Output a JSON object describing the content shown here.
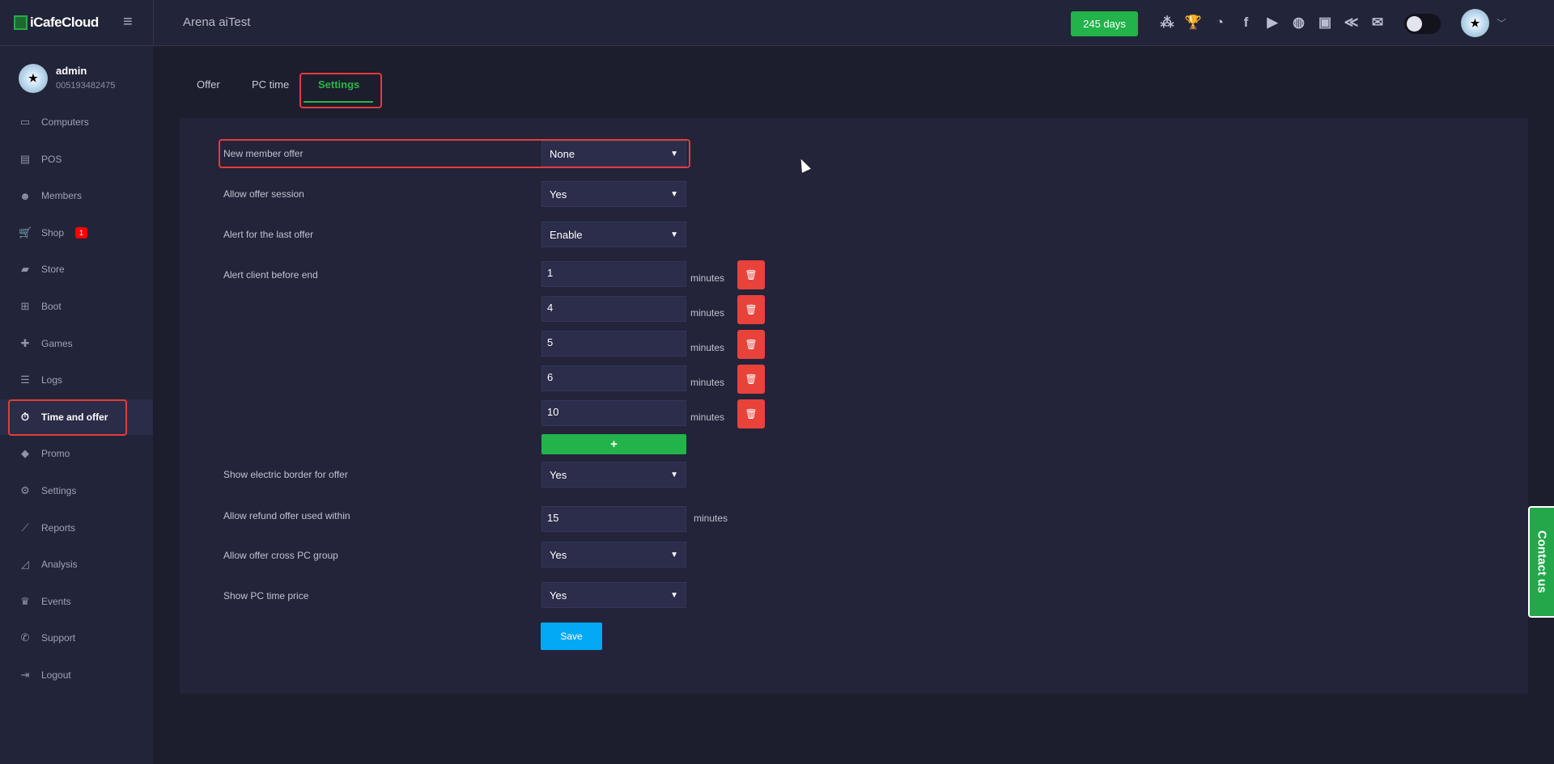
{
  "header": {
    "brand": "iCafeCloud",
    "title": "Arena aiTest",
    "days_badge": "245 days",
    "icons": [
      "ranking-icon",
      "trophy-icon",
      "rss-icon",
      "facebook-icon",
      "youtube-icon",
      "globe-icon",
      "icafe-icon",
      "sync-icon",
      "mail-icon"
    ],
    "icon_glyphs": [
      "⁂",
      "🏆",
      "◔",
      "f",
      "▶",
      "◍",
      "▣",
      "≪",
      "✉"
    ]
  },
  "profile": {
    "name": "admin",
    "id": "005193482475"
  },
  "sidebar": {
    "items": [
      {
        "label": "Computers",
        "icon": "▭"
      },
      {
        "label": "POS",
        "icon": "▤"
      },
      {
        "label": "Members",
        "icon": "☻"
      },
      {
        "label": "Shop",
        "icon": "🛒",
        "badge": "1"
      },
      {
        "label": "Store",
        "icon": "▰"
      },
      {
        "label": "Boot",
        "icon": "⊞"
      },
      {
        "label": "Games",
        "icon": "✚"
      },
      {
        "label": "Logs",
        "icon": "☰"
      },
      {
        "label": "Time and offer",
        "icon": "⏱"
      },
      {
        "label": "Promo",
        "icon": "◆"
      },
      {
        "label": "Settings",
        "icon": "⚙"
      },
      {
        "label": "Reports",
        "icon": "⟋"
      },
      {
        "label": "Analysis",
        "icon": "◿"
      },
      {
        "label": "Events",
        "icon": "♛"
      },
      {
        "label": "Support",
        "icon": "✆"
      },
      {
        "label": "Logout",
        "icon": "⇥"
      }
    ]
  },
  "tabs": [
    "Offer",
    "PC time",
    "Settings"
  ],
  "form": {
    "new_member_offer": {
      "label": "New member offer",
      "value": "None"
    },
    "allow_offer_session": {
      "label": "Allow offer session",
      "value": "Yes"
    },
    "alert_last_offer": {
      "label": "Alert for the last offer",
      "value": "Enable"
    },
    "alert_before_end": {
      "label": "Alert client before end",
      "values": [
        "1",
        "4",
        "5",
        "6",
        "10"
      ],
      "unit": "minutes"
    },
    "electric_border": {
      "label": "Show electric border for offer",
      "value": "Yes"
    },
    "refund_within": {
      "label": "Allow refund offer used within",
      "value": "15",
      "unit": "minutes"
    },
    "cross_group": {
      "label": "Allow offer cross PC group",
      "value": "Yes"
    },
    "show_price": {
      "label": "Show PC time price",
      "value": "Yes"
    },
    "add_label": "+",
    "save_label": "Save"
  },
  "contact": "Contact us"
}
